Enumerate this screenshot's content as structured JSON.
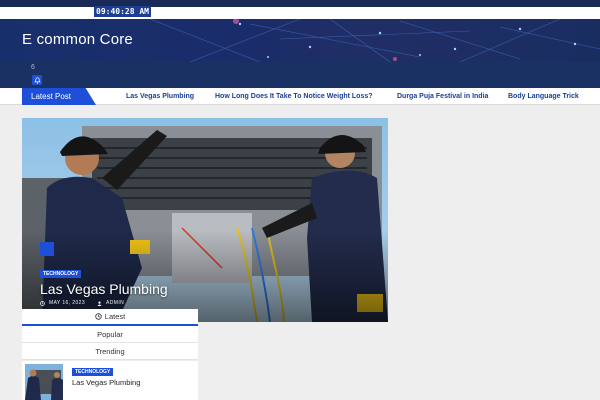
{
  "header": {
    "clock": "09:40:28 AM",
    "site_title": "E common Core",
    "notification_count": "6"
  },
  "news_ticker": {
    "label": "Latest Post",
    "items": [
      "Las Vegas Plumbing",
      "How Long Does It Take To Notice Weight Loss?",
      "Durga Puja Festival in India",
      "Body Language Trick"
    ]
  },
  "featured": {
    "category": "TECHNOLOGY",
    "title": "Las Vegas Plumbing",
    "date": "MAY 16, 2023",
    "author": "ADMIN"
  },
  "sidebar_tabs": {
    "tabs": [
      "Latest",
      "Popular",
      "Trending"
    ],
    "active": "Latest"
  },
  "sidebar_post": {
    "category": "TECHNOLOGY",
    "title": "Las Vegas Plumbing"
  },
  "colors": {
    "accent": "#1d4fd8",
    "nav_dark": "#1a2a57",
    "link": "#1a3f95"
  }
}
